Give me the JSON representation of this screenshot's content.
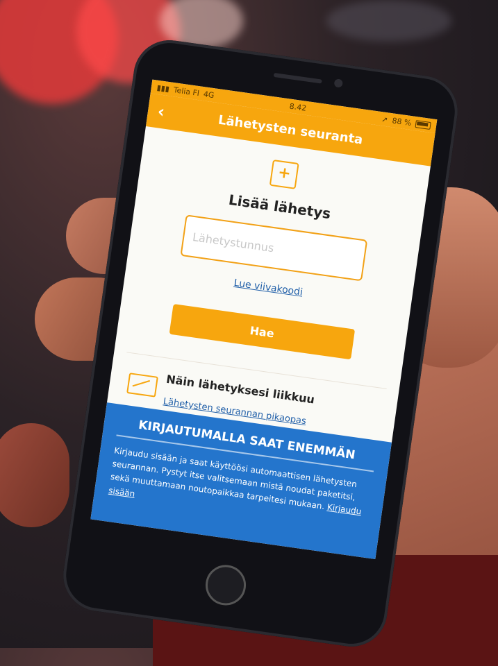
{
  "status": {
    "carrier": "Telia FI",
    "network": "4G",
    "time": "8.42",
    "battery": "88 %"
  },
  "header": {
    "title": "Lähetysten seuranta",
    "back_icon": "chevron-left-icon"
  },
  "add": {
    "icon": "package-add-icon",
    "title": "Lisää lähetys",
    "input_placeholder": "Lähetystunnus",
    "barcode_link": "Lue viivakoodi",
    "search_button": "Hae"
  },
  "guide": {
    "icon": "shipment-route-icon",
    "title": "Näin lähetyksesi liikkuu",
    "link": "Lähetysten seurannan pikaopas"
  },
  "promo": {
    "title": "KIRJAUTUMALLA SAAT ENEMMÄN",
    "text": "Kirjaudu sisään ja saat käyttöösi automaattisen lähetysten seurannan. Pystyt itse valitsemaan mistä noudat paketitsi, sekä muuttamaan noutopaikkaa tarpeitesi mukaan.",
    "link": "Kirjaudu sisään"
  },
  "colors": {
    "brand_orange": "#f7a60e",
    "promo_blue": "#2475cc",
    "link_blue": "#1f5ea8"
  }
}
